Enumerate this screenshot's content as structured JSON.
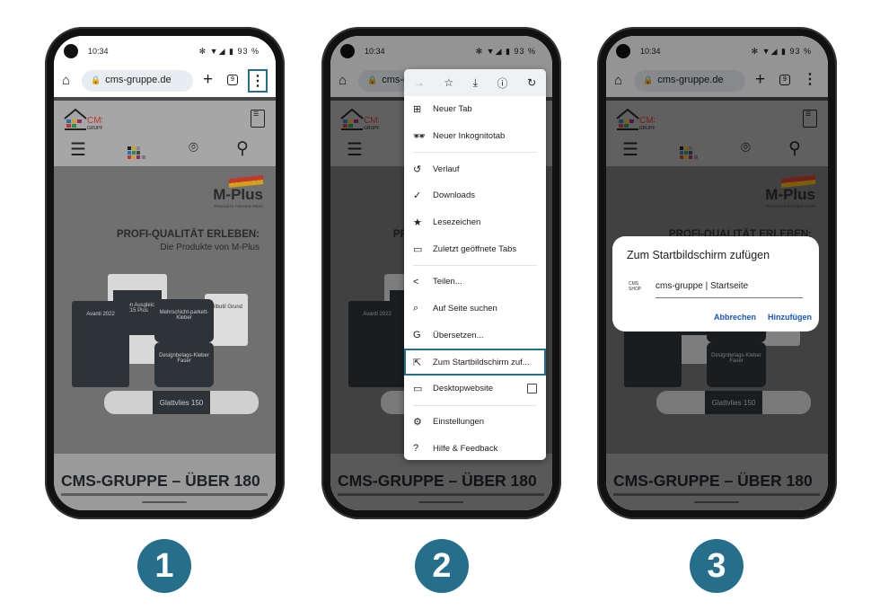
{
  "accent_color": "#266f8c",
  "status": {
    "time": "10:34",
    "icons": "✻ ▼◢ ▮",
    "battery": "93 %"
  },
  "browser": {
    "url": "cms-gruppe.de",
    "tab_count": "9"
  },
  "site": {
    "logo_text": "CMS",
    "logo_sub": "GRUPPE",
    "brand": "M-Plus",
    "brand_tagline": "PRODUKTE FÜR DEN PROFI",
    "headline": "PROFI-QUALITÄT ERLEBEN:",
    "subheadline": "Die Produkte von M-Plus",
    "products": [
      "Boden Ausgleich Z15 Plus",
      "Avanti 2022",
      "Mehrschicht-parkett-Kleber",
      "Silbutil Grund",
      "Designbelags-Kleber Faser",
      "Glattvlies 150"
    ],
    "bottom_heading": "CMS-GRUPPE – ÜBER 180"
  },
  "menu": {
    "top_icons": [
      "forward-icon",
      "star-icon",
      "download-icon",
      "info-icon",
      "reload-icon"
    ],
    "items": [
      {
        "icon": "⊞",
        "label": "Neuer Tab"
      },
      {
        "icon": "🕶",
        "label": "Neuer Inkognitotab"
      },
      {
        "icon": "↺",
        "label": "Verlauf"
      },
      {
        "icon": "✓",
        "label": "Downloads"
      },
      {
        "icon": "★",
        "label": "Lesezeichen"
      },
      {
        "icon": "▭",
        "label": "Zuletzt geöffnete Tabs"
      },
      {
        "icon": "<",
        "label": "Teilen..."
      },
      {
        "icon": "⌕",
        "label": "Auf Seite suchen"
      },
      {
        "icon": "G",
        "label": "Übersetzen..."
      },
      {
        "icon": "⇱",
        "label": "Zum Startbildschirm zuf..."
      },
      {
        "icon": "▭",
        "label": "Desktopwebsite"
      },
      {
        "icon": "⚙",
        "label": "Einstellungen"
      },
      {
        "icon": "?",
        "label": "Hilfe & Feedback"
      }
    ]
  },
  "dialog": {
    "title": "Zum Startbildschirm zufügen",
    "icon_text": "CMS SHOP",
    "value": "cms-gruppe | Startseite",
    "cancel": "Abbrechen",
    "add": "Hinzufügen"
  },
  "steps": [
    "1",
    "2",
    "3"
  ]
}
